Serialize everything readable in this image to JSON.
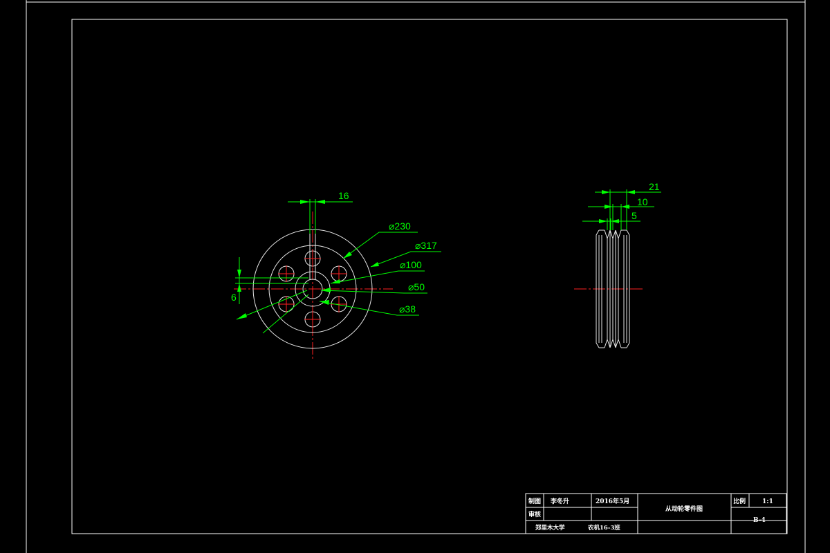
{
  "front_view": {
    "dims": {
      "keyway_width": "16",
      "d230": "⌀230",
      "d317": "⌀317",
      "d100": "⌀100",
      "d50": "⌀50",
      "d38": "⌀38",
      "keyway_depth": "6"
    }
  },
  "side_view": {
    "dims": {
      "w21": "21",
      "w10": "10",
      "w5": "5"
    }
  },
  "title_block": {
    "drawn_label": "制图",
    "drawn_by": "李冬升",
    "date": "2016年5月",
    "title": "从动轮零件图",
    "scale_label": "比例",
    "scale_value": "1:1",
    "review_label": "审核",
    "drawing_no": "B-4",
    "school": "郑里木大学",
    "class": "农机16-3班"
  },
  "colors": {
    "background": "#000000",
    "outline": "#ffffff",
    "dimension": "#00ff00",
    "centerline": "#ff0000"
  }
}
